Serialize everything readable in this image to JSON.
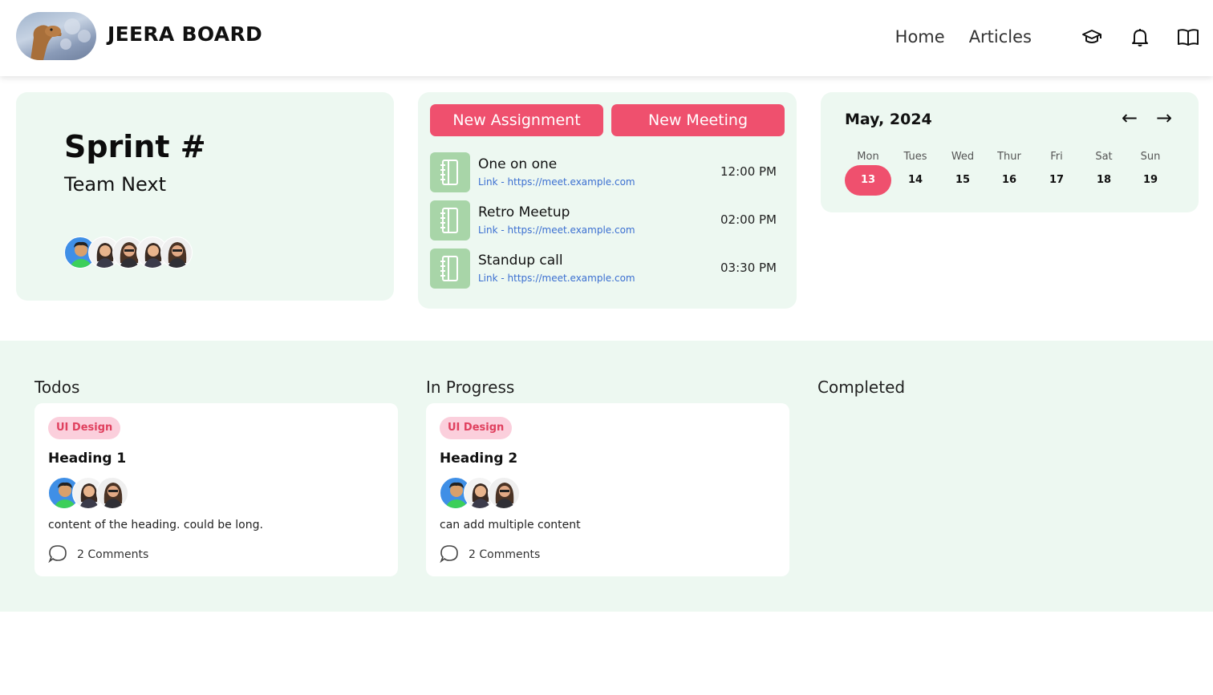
{
  "header": {
    "brand": "JEERA BOARD",
    "nav": {
      "home": "Home",
      "articles": "Articles"
    },
    "icons": [
      "graduation-cap-icon",
      "bell-icon",
      "book-icon"
    ]
  },
  "sprint": {
    "title": "Sprint #",
    "team": "Team Next",
    "members": [
      {
        "avatar": "avatar-male-blue"
      },
      {
        "avatar": "avatar-female-suit"
      },
      {
        "avatar": "avatar-female-glasses"
      },
      {
        "avatar": "avatar-female-suit"
      },
      {
        "avatar": "avatar-female-glasses"
      }
    ]
  },
  "meetings": {
    "new_assignment": "New Assignment",
    "new_meeting": "New Meeting",
    "items": [
      {
        "title": "One on one",
        "link": "Link - https://meet.example.com",
        "time": "12:00 PM",
        "icon": "notebook-icon"
      },
      {
        "title": "Retro Meetup",
        "link": "Link - https://meet.example.com",
        "time": "02:00 PM",
        "icon": "notebook-icon"
      },
      {
        "title": "Standup call",
        "link": "Link - https://meet.example.com",
        "time": "03:30 PM",
        "icon": "notebook-icon"
      }
    ]
  },
  "calendar": {
    "month": "May, 2024",
    "prev": "←",
    "next": "→",
    "days": [
      "Mon",
      "Tues",
      "Wed",
      "Thur",
      "Fri",
      "Sat",
      "Sun"
    ],
    "dates": [
      "13",
      "14",
      "15",
      "16",
      "17",
      "18",
      "19"
    ],
    "selected": "13"
  },
  "board": {
    "columns": [
      {
        "title": "Todos",
        "tasks": [
          {
            "tag": "UI Design",
            "heading": "Heading 1",
            "content": "content of the heading. could be long.",
            "comments": "2 Comments"
          }
        ]
      },
      {
        "title": "In Progress",
        "tasks": [
          {
            "tag": "UI Design",
            "heading": "Heading 2",
            "content": "can add multiple content",
            "comments": "2 Comments"
          }
        ]
      },
      {
        "title": "Completed",
        "tasks": []
      }
    ]
  },
  "colors": {
    "accent": "#ef506e",
    "panel": "#edf8f1",
    "tag_bg": "#fbcfdc",
    "meet_icon": "#a8d5a8",
    "link": "#3b6fd1"
  }
}
